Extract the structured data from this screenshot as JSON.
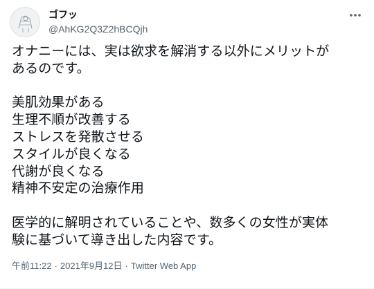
{
  "user": {
    "display_name": "ゴフッ",
    "handle": "@AhKG2Q3Z2hBCQjh"
  },
  "icons": {
    "avatar": "avatar-sketch-icon",
    "more": "more-horizontal-icon"
  },
  "tweet": {
    "intro_lines": [
      "オナニーには、実は欲求を解消する以外にメリットが",
      "あるのです。"
    ],
    "benefits": [
      "美肌効果がある",
      "生理不順が改善する",
      "ストレスを発散させる",
      "スタイルが良くなる",
      "代謝が良くなる",
      "精神不安定の治療作用"
    ],
    "outro_lines": [
      "医学的に解明されていることや、数多くの女性が実体",
      "験に基づいて導き出した内容です。"
    ]
  },
  "meta": {
    "time": "午前11:22",
    "separator": "·",
    "date": "2021年9月12日",
    "source": "Twitter Web App"
  },
  "colors": {
    "text": "#0f1419",
    "secondary": "#536471"
  }
}
